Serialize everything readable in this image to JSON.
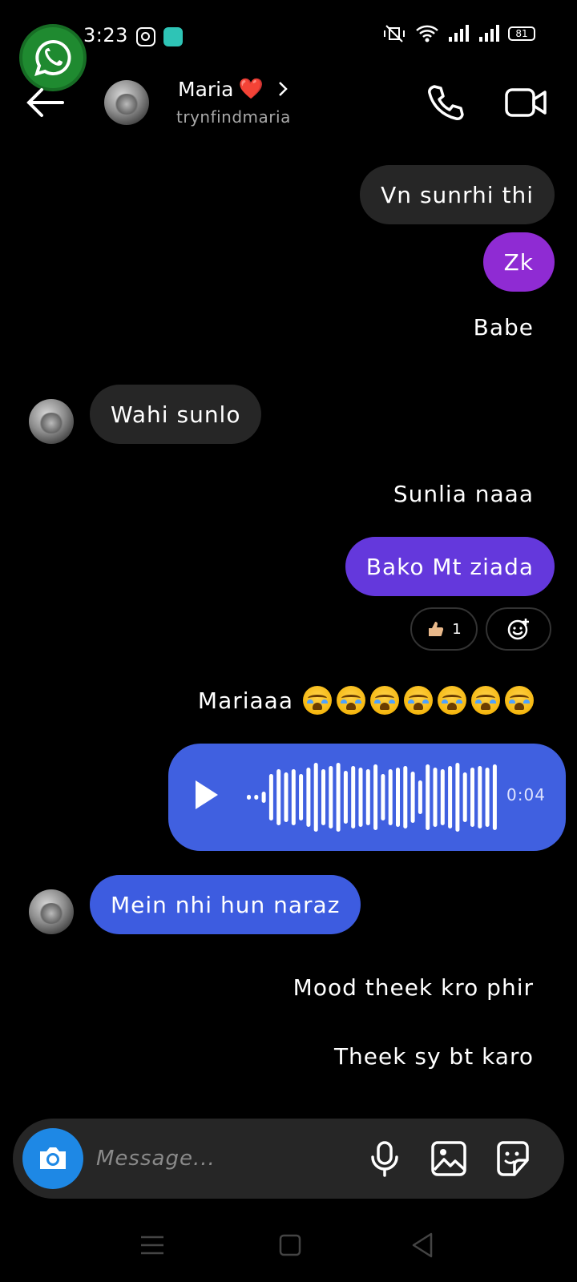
{
  "status_bar": {
    "time": "3:23",
    "battery": "81"
  },
  "header": {
    "name": "Maria",
    "heart": "❤️",
    "username": "trynfindmaria"
  },
  "messages": {
    "m1": "Vn sunrhi thi",
    "m2": "Zk",
    "m3": "Babe",
    "m4": "Wahi sunlo",
    "m5": "Sunlia naaa",
    "m6": "Bako Mt ziada",
    "m6_reaction_count": "1",
    "m7": "Mariaaa",
    "m7_emoji_count": 7,
    "voice_duration": "0:04",
    "m8": "Mein nhi hun naraz",
    "m9": "Mood theek kro phir",
    "m10": "Theek sy bt karo"
  },
  "composer": {
    "placeholder": "Message..."
  },
  "colors": {
    "accent_purple": "#8f2bd3",
    "accent_violet": "#6438dc",
    "accent_blue": "#3d5ce0",
    "camera_blue": "#1e88e5"
  }
}
